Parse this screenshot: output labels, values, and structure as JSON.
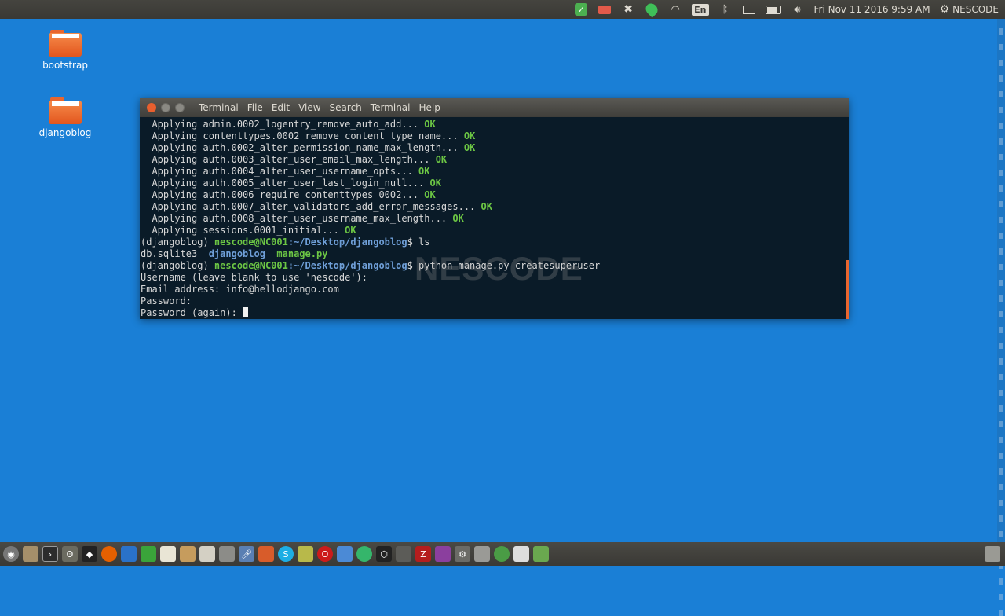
{
  "top_panel": {
    "keyboard_layout": "En",
    "datetime": "Fri Nov 11 2016  9:59 AM",
    "session_label": "NESCODE"
  },
  "desktop": {
    "icons": [
      {
        "label": "bootstrap"
      },
      {
        "label": "djangoblog"
      }
    ]
  },
  "terminal": {
    "menu": [
      "Terminal",
      "File",
      "Edit",
      "View",
      "Search",
      "Terminal",
      "Help"
    ],
    "migrations": [
      "admin.0002_logentry_remove_auto_add",
      "contenttypes.0002_remove_content_type_name",
      "auth.0002_alter_permission_name_max_length",
      "auth.0003_alter_user_email_max_length",
      "auth.0004_alter_user_username_opts",
      "auth.0005_alter_user_last_login_null",
      "auth.0006_require_contenttypes_0002",
      "auth.0007_alter_validators_add_error_messages",
      "auth.0008_alter_user_username_max_length",
      "sessions.0001_initial"
    ],
    "apply_prefix": "  Applying ",
    "apply_suffix": "... ",
    "ok_label": "OK",
    "venv": "(djangoblog) ",
    "user_host": "nescode@NC001",
    "path": ":~/Desktop/djangoblog",
    "prompt_symbol": "$ ",
    "cmd1": "ls",
    "ls_file1": "db.sqlite3",
    "ls_dir": "djangoblog",
    "ls_file2": "manage.py",
    "cmd2": "python manage.py createsuperuser",
    "username_prompt": "Username (leave blank to use 'nescode'):",
    "email_prompt": "Email address: info@hellodjango.com",
    "password_prompt": "Password:",
    "password_again_prompt": "Password (again): ",
    "watermark": "NESCODE"
  },
  "colors": {
    "desktop_bg": "#1a7fd6",
    "terminal_bg": "#0a1b28",
    "ok_green": "#6cc644",
    "path_blue": "#6f9fd8",
    "accent_orange": "#e85f2e"
  },
  "taskbar": {
    "apps": [
      "dash-icon",
      "files-icon",
      "terminal-icon",
      "gimp-icon",
      "inkscape-icon",
      "firefox-icon",
      "writer-icon",
      "calc-icon",
      "text-editor-icon",
      "archive-icon",
      "clipboard-icon",
      "trash-like-icon",
      "microphone-icon",
      "tool-icon",
      "skype-icon",
      "notes-icon",
      "opera-icon",
      "virtualbox-icon",
      "chat-icon",
      "cube-icon",
      "document-icon",
      "filezilla-icon",
      "screen-recorder-icon",
      "settings-icon",
      "database-icon",
      "chrome-icon",
      "home-icon",
      "android-icon"
    ]
  }
}
